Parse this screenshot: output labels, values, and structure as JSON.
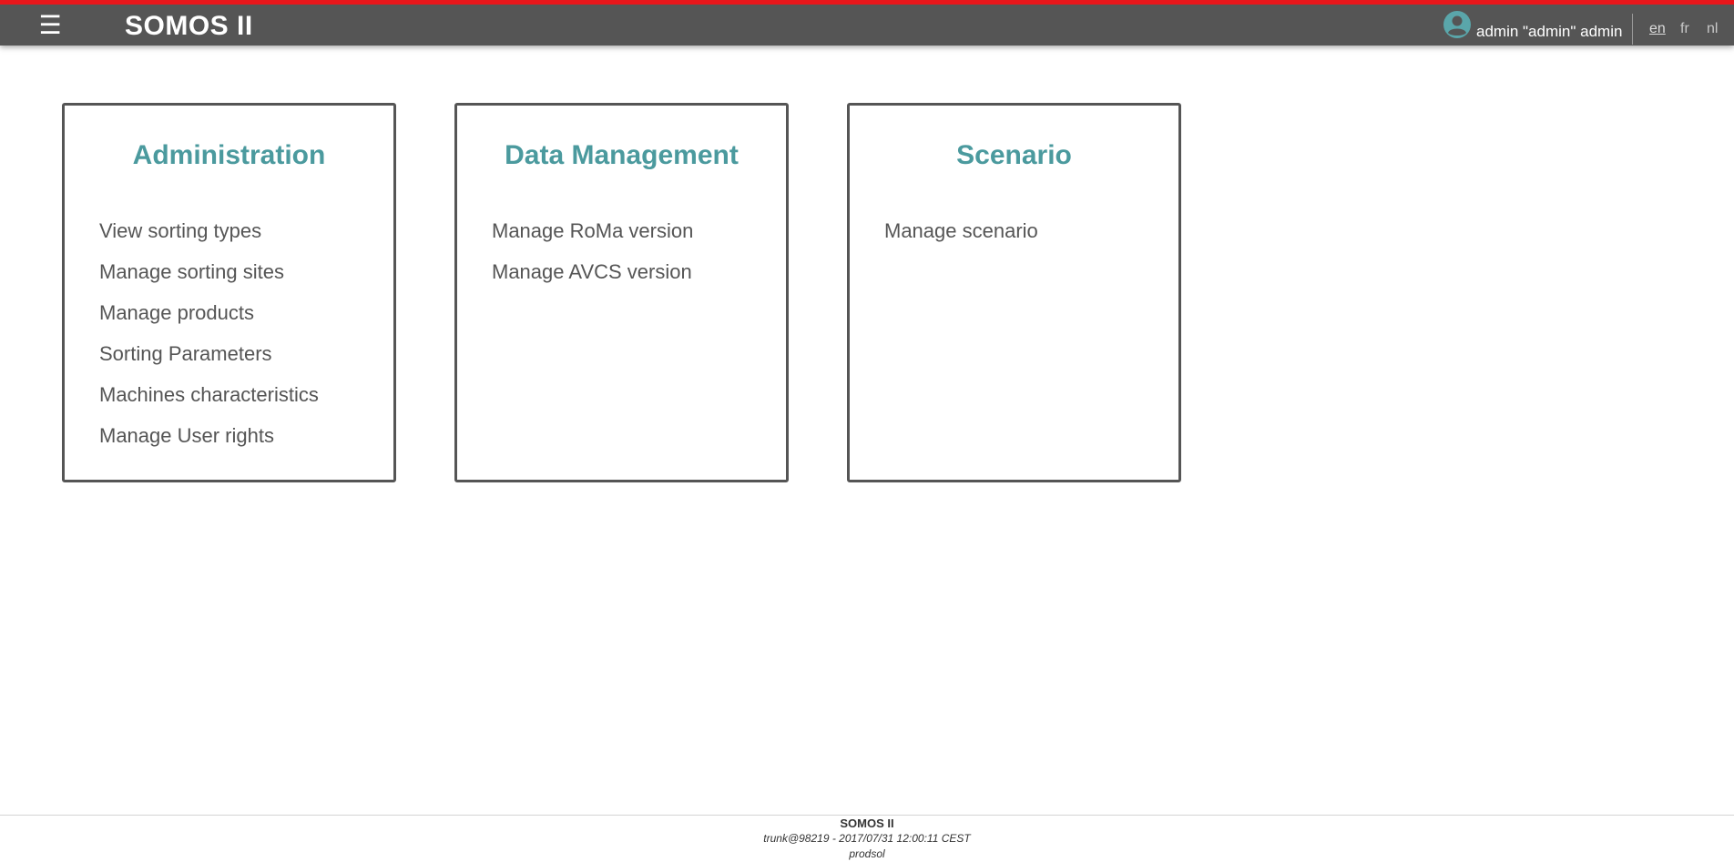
{
  "header": {
    "menu_glyph": "☰",
    "app_title": "SOMOS II",
    "user_icon": "user-circle-icon",
    "user_name": "admin \"admin\" admin",
    "languages": [
      "en",
      "fr",
      "nl"
    ],
    "active_language": "en",
    "accent_color": "#e8161b",
    "bar_color": "#555555"
  },
  "cards": [
    {
      "title": "Administration",
      "items": [
        "View sorting types",
        "Manage sorting sites",
        "Manage products",
        "Sorting Parameters",
        "Machines characteristics",
        "Manage User rights"
      ]
    },
    {
      "title": "Data Management",
      "items": [
        "Manage RoMa version",
        "Manage AVCS version"
      ]
    },
    {
      "title": "Scenario",
      "items": [
        "Manage scenario"
      ]
    }
  ],
  "title_color": "#4b9a9e",
  "footer": {
    "app_name": "SOMOS II",
    "build": "trunk@98219 - 2017/07/31 12:00:11 CEST",
    "environment": "prodsol"
  }
}
